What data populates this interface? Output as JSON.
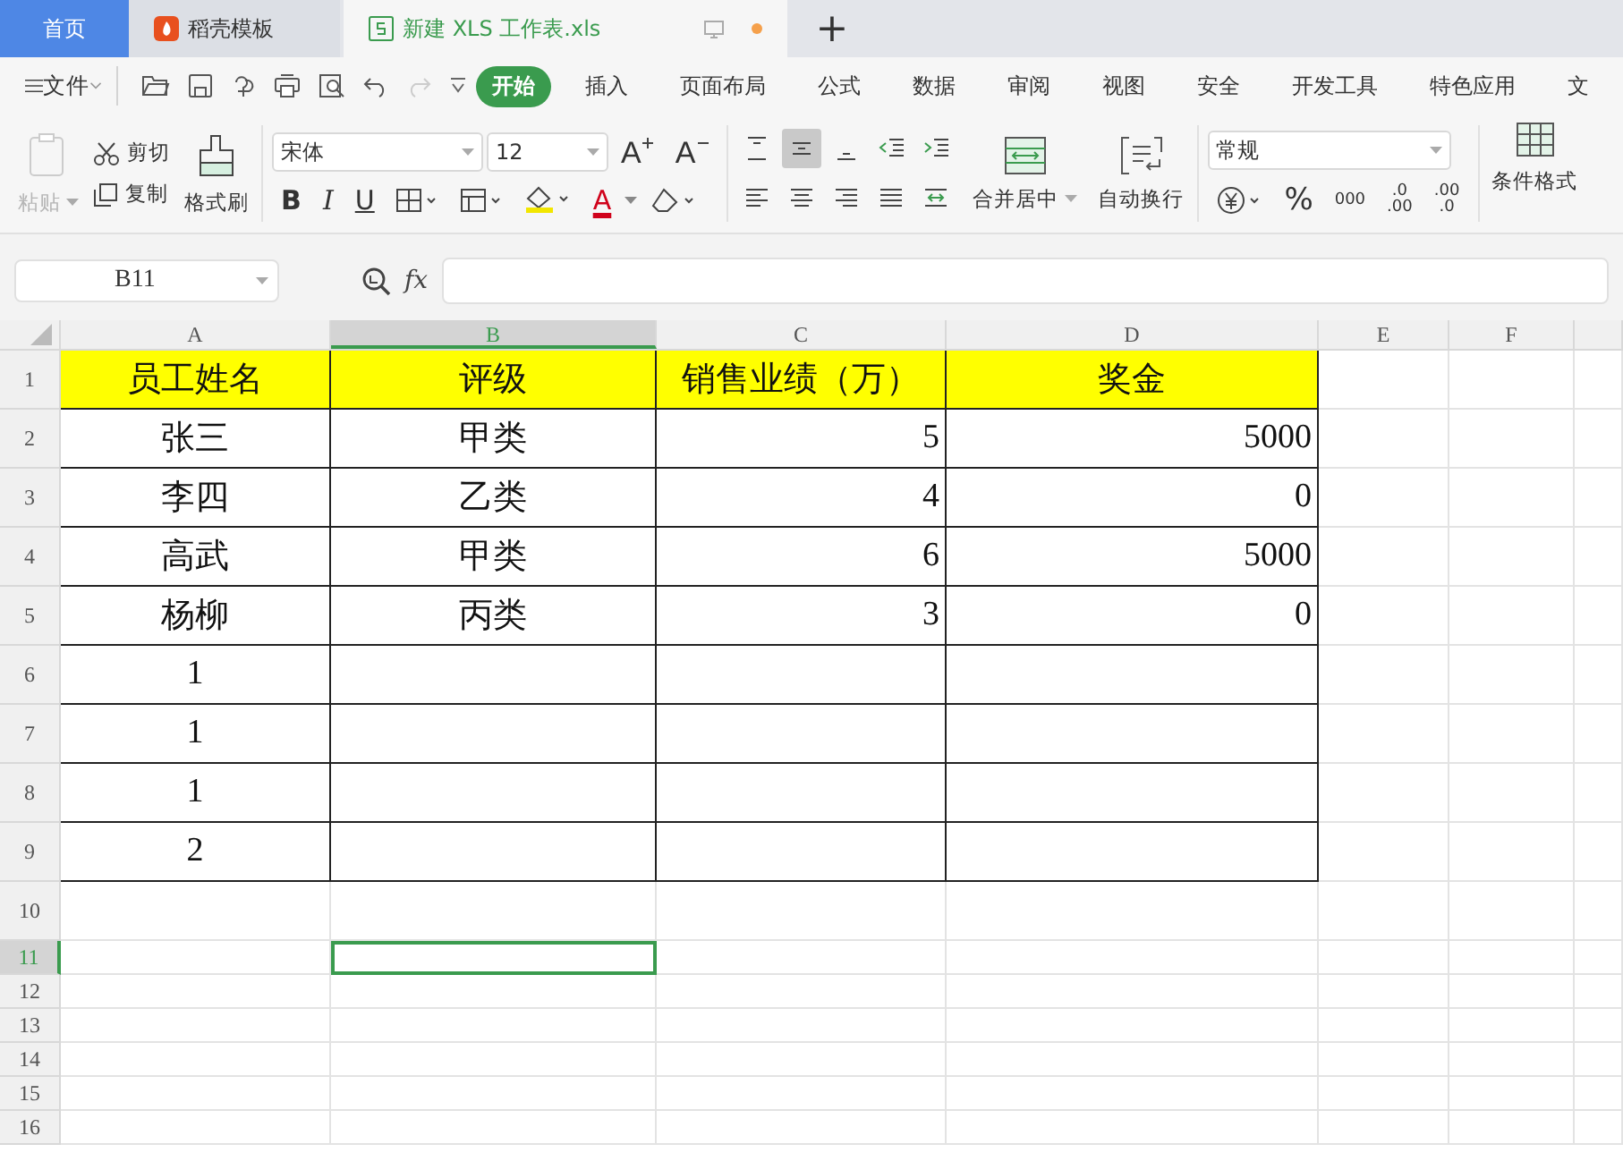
{
  "tabs": [
    {
      "label": "首页",
      "kind": "home",
      "selected": false
    },
    {
      "label": "稻壳模板",
      "kind": "docer",
      "selected": false
    },
    {
      "label": "新建 XLS 工作表.xls",
      "kind": "sheet",
      "selected": true
    }
  ],
  "new_tab": "+",
  "menu": {
    "file": "文件",
    "tabs": [
      {
        "label": "开始",
        "selected": true
      },
      {
        "label": "插入",
        "selected": false
      },
      {
        "label": "页面布局",
        "selected": false
      },
      {
        "label": "公式",
        "selected": false
      },
      {
        "label": "数据",
        "selected": false
      },
      {
        "label": "审阅",
        "selected": false
      },
      {
        "label": "视图",
        "selected": false
      },
      {
        "label": "安全",
        "selected": false
      },
      {
        "label": "开发工具",
        "selected": false
      },
      {
        "label": "特色应用",
        "selected": false
      },
      {
        "label": "文",
        "selected": false
      }
    ]
  },
  "ribbon": {
    "paste": {
      "label": "粘贴",
      "disabled": true
    },
    "cut": "剪切",
    "copy": "复制",
    "format_painter": "格式刷",
    "font": "宋体",
    "size": "12",
    "grow": "A",
    "shrink": "A",
    "bold": "B",
    "italic": "I",
    "underline": "U",
    "font_color": "A",
    "align_buttons": [
      {
        "kind": "top",
        "selected": false
      },
      {
        "kind": "middle",
        "selected": true
      },
      {
        "kind": "bottom",
        "selected": false
      },
      {
        "kind": "outdent",
        "selected": false
      },
      {
        "kind": "indent",
        "selected": false
      },
      {
        "kind": "left",
        "selected": false
      },
      {
        "kind": "center",
        "selected": false
      },
      {
        "kind": "right",
        "selected": false
      },
      {
        "kind": "justify",
        "selected": false
      },
      {
        "kind": "distribute",
        "selected": false
      }
    ],
    "merge": "合并居中",
    "wrap": "自动换行",
    "number_format": "常规",
    "percent": "%",
    "thousands": "000",
    "decimal_add": [
      ".0",
      ".00"
    ],
    "decimal_remove": [
      ".00",
      ".0"
    ],
    "conditional": "条件格式"
  },
  "formula_bar": {
    "name_box": "B11",
    "fx": "fx"
  },
  "grid": {
    "columns": [
      {
        "label": "A",
        "selected": false
      },
      {
        "label": "B",
        "selected": true
      },
      {
        "label": "C",
        "selected": false
      },
      {
        "label": "D",
        "selected": false
      },
      {
        "label": "E",
        "selected": false
      },
      {
        "label": "F",
        "selected": false
      }
    ],
    "rows": [
      {
        "label": "1",
        "selected": false,
        "bordered": true,
        "highlighted": true,
        "cells": [
          {
            "text": "员工姓名",
            "kind": "label"
          },
          {
            "text": "评级",
            "kind": "label"
          },
          {
            "text": "销售业绩（万）",
            "kind": "label"
          },
          {
            "text": "奖金",
            "kind": "label"
          },
          {},
          {}
        ]
      },
      {
        "label": "2",
        "selected": false,
        "bordered": true,
        "highlighted": false,
        "cells": [
          {
            "text": "张三",
            "kind": "label"
          },
          {
            "text": "甲类",
            "kind": "label"
          },
          {
            "text": "5",
            "kind": "number"
          },
          {
            "text": "5000",
            "kind": "number"
          },
          {},
          {}
        ]
      },
      {
        "label": "3",
        "selected": false,
        "bordered": true,
        "highlighted": false,
        "cells": [
          {
            "text": "李四",
            "kind": "label"
          },
          {
            "text": "乙类",
            "kind": "label"
          },
          {
            "text": "4",
            "kind": "number"
          },
          {
            "text": "0",
            "kind": "number"
          },
          {},
          {}
        ]
      },
      {
        "label": "4",
        "selected": false,
        "bordered": true,
        "highlighted": false,
        "cells": [
          {
            "text": "高武",
            "kind": "label"
          },
          {
            "text": "甲类",
            "kind": "label"
          },
          {
            "text": "6",
            "kind": "number"
          },
          {
            "text": "5000",
            "kind": "number"
          },
          {},
          {}
        ]
      },
      {
        "label": "5",
        "selected": false,
        "bordered": true,
        "highlighted": false,
        "cells": [
          {
            "text": "杨柳",
            "kind": "label"
          },
          {
            "text": "丙类",
            "kind": "label"
          },
          {
            "text": "3",
            "kind": "number"
          },
          {
            "text": "0",
            "kind": "number"
          },
          {},
          {}
        ]
      },
      {
        "label": "6",
        "selected": false,
        "bordered": true,
        "highlighted": false,
        "cells": [
          {
            "text": "1",
            "kind": "label"
          },
          {},
          {},
          {},
          {},
          {}
        ]
      },
      {
        "label": "7",
        "selected": false,
        "bordered": true,
        "highlighted": false,
        "cells": [
          {
            "text": "1",
            "kind": "label"
          },
          {},
          {},
          {},
          {},
          {}
        ]
      },
      {
        "label": "8",
        "selected": false,
        "bordered": true,
        "highlighted": false,
        "cells": [
          {
            "text": "1",
            "kind": "label"
          },
          {},
          {},
          {},
          {},
          {}
        ]
      },
      {
        "label": "9",
        "selected": false,
        "bordered": true,
        "highlighted": false,
        "cells": [
          {
            "text": "2",
            "kind": "label"
          },
          {},
          {},
          {},
          {},
          {}
        ]
      },
      {
        "label": "10",
        "selected": false,
        "bordered": false,
        "highlighted": false,
        "cells": [
          {},
          {},
          {},
          {},
          {},
          {}
        ]
      },
      {
        "label": "11",
        "selected": true,
        "bordered": false,
        "highlighted": false,
        "cells": [
          {},
          {
            "selected": true
          },
          {},
          {},
          {},
          {}
        ]
      },
      {
        "label": "12",
        "selected": false,
        "bordered": false,
        "highlighted": false,
        "cells": [
          {},
          {},
          {},
          {},
          {},
          {}
        ]
      },
      {
        "label": "13",
        "selected": false,
        "bordered": false,
        "highlighted": false,
        "cells": [
          {},
          {},
          {},
          {},
          {},
          {}
        ]
      },
      {
        "label": "14",
        "selected": false,
        "bordered": false,
        "highlighted": false,
        "cells": [
          {},
          {},
          {},
          {},
          {},
          {}
        ]
      },
      {
        "label": "15",
        "selected": false,
        "bordered": false,
        "highlighted": false,
        "cells": [
          {},
          {},
          {},
          {},
          {},
          {}
        ]
      },
      {
        "label": "16",
        "selected": false,
        "bordered": false,
        "highlighted": false,
        "cells": [
          {},
          {},
          {},
          {},
          {},
          {}
        ]
      }
    ]
  }
}
